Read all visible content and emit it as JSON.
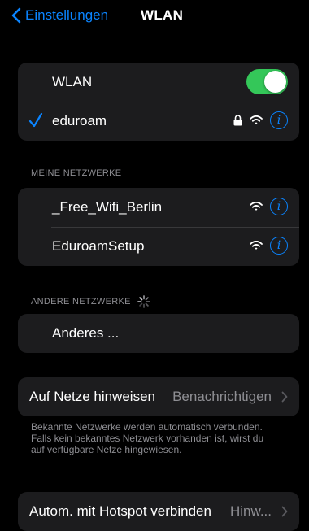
{
  "nav": {
    "back_label": "Einstellungen",
    "title": "WLAN"
  },
  "wlan_group": {
    "toggle_label": "WLAN",
    "toggle_on": true,
    "connected_network": "eduroam"
  },
  "my_networks": {
    "header": "MEINE NETZWERKE",
    "items": [
      {
        "name": "_Free_Wifi_Berlin"
      },
      {
        "name": "EduroamSetup"
      }
    ]
  },
  "other_networks": {
    "header": "ANDERE NETZWERKE",
    "other_label": "Anderes ..."
  },
  "ask_join": {
    "label": "Auf Netze hinweisen",
    "value": "Benachrichtigen",
    "footer": "Bekannte Netzwerke werden automatisch verbunden. Falls kein bekanntes Netzwerk vorhanden ist, wirst du auf verfügbare Netze hingewiesen."
  },
  "hotspot": {
    "label": "Autom. mit Hotspot verbinden",
    "value": "Hinw..."
  },
  "info_glyph": "i",
  "colors": {
    "accent": "#0a84ff",
    "toggle_on": "#34c759",
    "background": "#000000",
    "cell": "#1c1c1e"
  }
}
